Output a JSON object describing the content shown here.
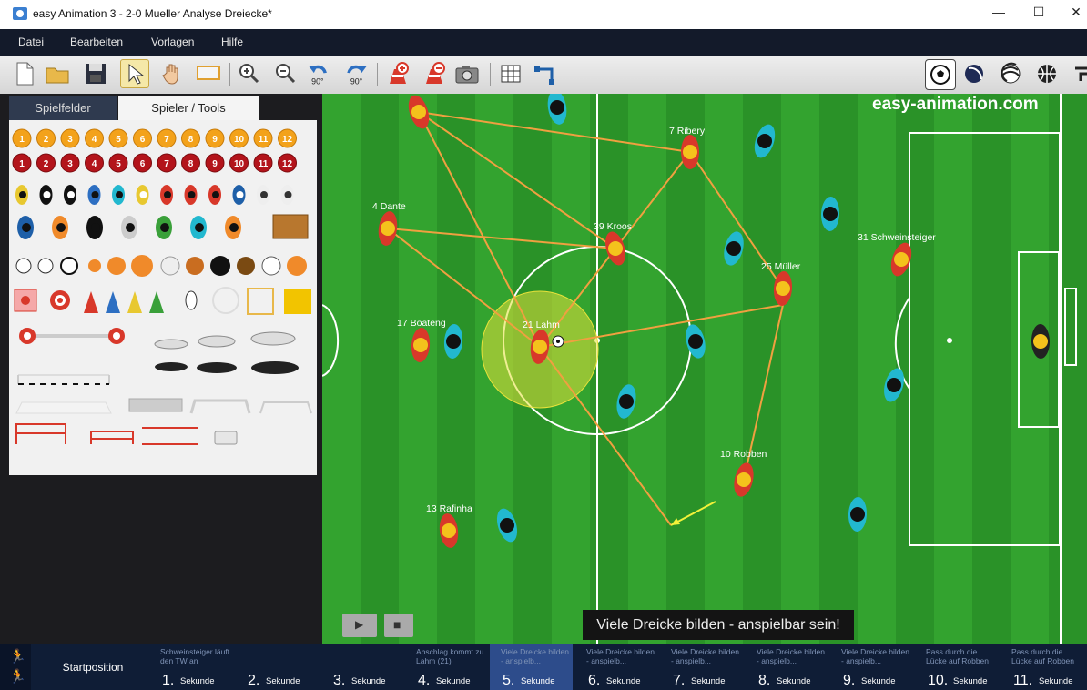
{
  "window": {
    "title": "easy Animation 3 - 2-0 Mueller Analyse Dreiecke*",
    "controls": [
      "—",
      "☐",
      "✕"
    ]
  },
  "menubar": {
    "items": [
      "Datei",
      "Bearbeiten",
      "Vorlagen",
      "Hilfe"
    ]
  },
  "toolbar": {
    "buttons": [
      "new-file",
      "open-folder",
      "save",
      "select-arrow",
      "hand-pan",
      "rectangle-select",
      "zoom-in",
      "zoom-out",
      "rotate-left-90",
      "rotate-right-90",
      "add-cone",
      "remove-cone",
      "camera",
      "grid",
      "path-line"
    ],
    "rotate_left_label": "90°",
    "rotate_right_label": "90°",
    "sports": [
      "soccer-ball",
      "volleyball",
      "volleyball-striped",
      "basketball",
      "other-sport"
    ]
  },
  "left_panel": {
    "tabs": [
      "Spielfelder",
      "Spieler / Tools"
    ],
    "active_tab": "Spieler / Tools",
    "numbers_orange": [
      "1",
      "2",
      "3",
      "4",
      "5",
      "6",
      "7",
      "8",
      "9",
      "10",
      "11",
      "12"
    ],
    "numbers_red": [
      "1",
      "2",
      "3",
      "4",
      "5",
      "6",
      "7",
      "8",
      "9",
      "10",
      "11",
      "12"
    ]
  },
  "field": {
    "watermark": "easy-animation.com",
    "players": [
      {
        "label": "7 Ribery"
      },
      {
        "label": "4 Dante"
      },
      {
        "label": "39 Kroos"
      },
      {
        "label": "31 Schweinsteiger"
      },
      {
        "label": "25 Müller"
      },
      {
        "label": "17 Boateng"
      },
      {
        "label": "21 Lahm"
      },
      {
        "label": "10 Robben"
      },
      {
        "label": "13 Rafinha"
      }
    ],
    "caption": "Viele Dreicke bilden - anspielbar sein!",
    "play_icon": "▶",
    "stop_icon": "■",
    "colors": {
      "grass": "#2e9a2a",
      "team_red": "#d8382a",
      "team_cyan": "#22b8cf",
      "pass_line": "#f0a040",
      "highlight": "#e8e23a"
    }
  },
  "timeline": {
    "start_label": "Startposition",
    "unit": "Sekunde",
    "steps": [
      {
        "num": "1.",
        "note": "Schweinsteiger läuft den TW an"
      },
      {
        "num": "2.",
        "note": ""
      },
      {
        "num": "3.",
        "note": ""
      },
      {
        "num": "4.",
        "note": "Abschlag kommt zu Lahm (21)"
      },
      {
        "num": "5.",
        "note": "Viele Dreicke bilden - anspielb..."
      },
      {
        "num": "6.",
        "note": "Viele Dreicke bilden - anspielb..."
      },
      {
        "num": "7.",
        "note": "Viele Dreicke bilden - anspielb..."
      },
      {
        "num": "8.",
        "note": "Viele Dreicke bilden - anspielb..."
      },
      {
        "num": "9.",
        "note": "Viele Dreicke bilden - anspielb..."
      },
      {
        "num": "10.",
        "note": "Pass durch die Lücke auf Robben"
      },
      {
        "num": "11.",
        "note": "Pass durch die Lücke auf Robben"
      }
    ],
    "current_step": "5."
  }
}
